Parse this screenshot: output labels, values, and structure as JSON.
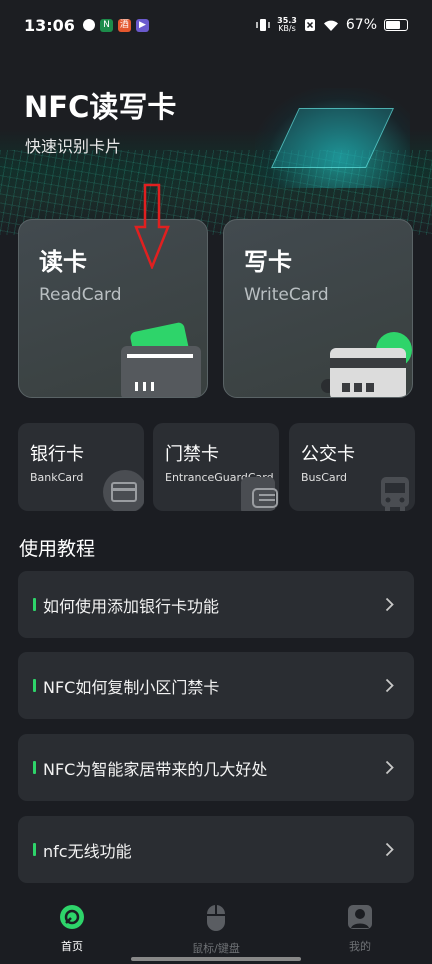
{
  "status_bar": {
    "time": "13:06",
    "net_speed_value": "35.3",
    "net_speed_unit": "KB/s",
    "battery": "67%"
  },
  "header": {
    "title": "NFC读写卡",
    "subtitle": "快速识别卡片"
  },
  "main_cards": [
    {
      "title": "读卡",
      "subtitle": "ReadCard"
    },
    {
      "title": "写卡",
      "subtitle": "WriteCard"
    }
  ],
  "card_types": [
    {
      "title": "银行卡",
      "subtitle": "BankCard",
      "icon": "bank-card-icon"
    },
    {
      "title": "门禁卡",
      "subtitle": "EntranceGuardCard",
      "icon": "access-card-icon"
    },
    {
      "title": "公交卡",
      "subtitle": "BusCard",
      "icon": "bus-icon"
    }
  ],
  "tutorials": {
    "title": "使用教程",
    "items": [
      "如何使用添加银行卡功能",
      "NFC如何复制小区门禁卡",
      "NFC为智能家居带来的几大好处",
      "nfc无线功能"
    ]
  },
  "bottom_nav": [
    {
      "label": "首页",
      "icon": "home-icon",
      "active": true
    },
    {
      "label": "鼠标/键盘",
      "icon": "mouse-icon",
      "active": false
    },
    {
      "label": "我的",
      "icon": "profile-icon",
      "active": false
    }
  ],
  "colors": {
    "accent": "#2ed46a",
    "background": "#1b1d22",
    "card": "#2a2d32",
    "annotation": "#e02020"
  }
}
